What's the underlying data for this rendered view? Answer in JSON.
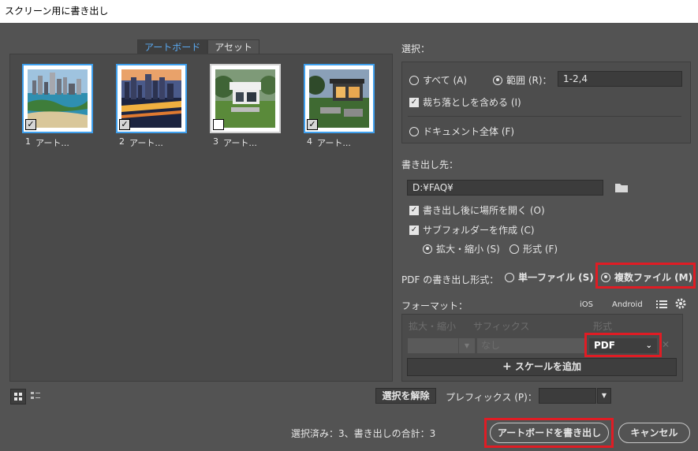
{
  "window": {
    "title": "スクリーン用に書き出し"
  },
  "tabs": [
    {
      "label": "アートボード"
    },
    {
      "label": "アセット"
    }
  ],
  "artboards": [
    {
      "number": "1",
      "name": "アート...",
      "checked": true
    },
    {
      "number": "2",
      "name": "アート...",
      "checked": true
    },
    {
      "number": "3",
      "name": "アート...",
      "checked": false
    },
    {
      "number": "4",
      "name": "アート...",
      "checked": true
    }
  ],
  "select": {
    "section_label": "選択：",
    "all_label": "すべて (A)",
    "range_label": "範囲 (R)：",
    "range_value": "1-2,4",
    "include_bleed_label": "裁ち落としを含める (I)",
    "whole_doc_label": "ドキュメント全体 (F)"
  },
  "export_to": {
    "section_label": "書き出し先：",
    "path": "D:¥FAQ¥",
    "open_after_label": "書き出し後に場所を開く (O)",
    "create_subfolders_label": "サブフォルダーを作成 (C)",
    "by_scale_label": "拡大・縮小 (S)",
    "by_format_label": "形式 (F)"
  },
  "pdf_export": {
    "label": "PDF の書き出し形式：",
    "single_label": "単一ファイル (S)",
    "multiple_label": "複数ファイル (M)"
  },
  "format": {
    "section_label": "フォーマット：",
    "ios_label": "iOS",
    "android_label": "Android",
    "col_scale": "拡大・縮小",
    "col_suffix": "サフィックス",
    "col_format": "形式",
    "suffix_placeholder": "なし",
    "format_value": "PDF",
    "add_scale_label": "スケールを追加",
    "add_scale_icon": "+"
  },
  "bottom": {
    "deselect_label": "選択を解除",
    "prefix_label": "プレフィックス (P)：",
    "prefix_value": "",
    "status_text": "選択済み：3、書き出しの合計：3",
    "export_label": "アートボードを書き出し",
    "cancel_label": "キャンセル"
  },
  "colors": {
    "accent": "#3fa0ee",
    "highlight": "#e01c24",
    "background": "#535353"
  }
}
